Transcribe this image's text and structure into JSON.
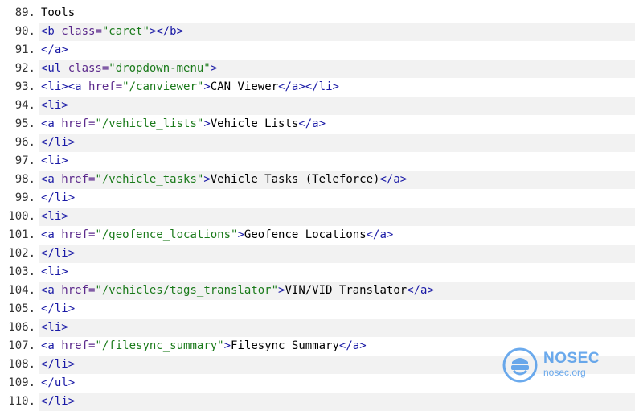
{
  "watermark": {
    "name": "NOSEC",
    "domain": "nosec.org"
  },
  "lines": [
    {
      "n": "89.",
      "parts": [
        {
          "c": "plain",
          "t": "Tools"
        }
      ]
    },
    {
      "n": "90.",
      "parts": [
        {
          "c": "tag",
          "t": "<b "
        },
        {
          "c": "attr",
          "t": "class="
        },
        {
          "c": "val",
          "t": "\"caret\""
        },
        {
          "c": "tag",
          "t": "></b>"
        }
      ]
    },
    {
      "n": "91.",
      "parts": [
        {
          "c": "tag",
          "t": "</a>"
        }
      ]
    },
    {
      "n": "92.",
      "parts": [
        {
          "c": "tag",
          "t": "<ul "
        },
        {
          "c": "attr",
          "t": "class="
        },
        {
          "c": "val",
          "t": "\"dropdown-menu\""
        },
        {
          "c": "tag",
          "t": ">"
        }
      ]
    },
    {
      "n": "93.",
      "parts": [
        {
          "c": "tag",
          "t": "<li><a "
        },
        {
          "c": "attr",
          "t": "href="
        },
        {
          "c": "val",
          "t": "\"/canviewer\""
        },
        {
          "c": "tag",
          "t": ">"
        },
        {
          "c": "plain",
          "t": "CAN Viewer"
        },
        {
          "c": "tag",
          "t": "</a></li>"
        }
      ]
    },
    {
      "n": "94.",
      "parts": [
        {
          "c": "tag",
          "t": "<li>"
        }
      ]
    },
    {
      "n": "95.",
      "parts": [
        {
          "c": "tag",
          "t": "<a "
        },
        {
          "c": "attr",
          "t": "href="
        },
        {
          "c": "val",
          "t": "\"/vehicle_lists\""
        },
        {
          "c": "tag",
          "t": ">"
        },
        {
          "c": "plain",
          "t": "Vehicle Lists"
        },
        {
          "c": "tag",
          "t": "</a>"
        }
      ]
    },
    {
      "n": "96.",
      "parts": [
        {
          "c": "tag",
          "t": "</li>"
        }
      ]
    },
    {
      "n": "97.",
      "parts": [
        {
          "c": "tag",
          "t": "<li>"
        }
      ]
    },
    {
      "n": "98.",
      "parts": [
        {
          "c": "tag",
          "t": "<a "
        },
        {
          "c": "attr",
          "t": "href="
        },
        {
          "c": "val",
          "t": "\"/vehicle_tasks\""
        },
        {
          "c": "tag",
          "t": ">"
        },
        {
          "c": "plain",
          "t": "Vehicle Tasks (Teleforce)"
        },
        {
          "c": "tag",
          "t": "</a>"
        }
      ]
    },
    {
      "n": "99.",
      "parts": [
        {
          "c": "tag",
          "t": "</li>"
        }
      ]
    },
    {
      "n": "100.",
      "parts": [
        {
          "c": "tag",
          "t": "<li>"
        }
      ]
    },
    {
      "n": "101.",
      "parts": [
        {
          "c": "tag",
          "t": "<a "
        },
        {
          "c": "attr",
          "t": "href="
        },
        {
          "c": "val",
          "t": "\"/geofence_locations\""
        },
        {
          "c": "tag",
          "t": ">"
        },
        {
          "c": "plain",
          "t": "Geofence Locations"
        },
        {
          "c": "tag",
          "t": "</a>"
        }
      ]
    },
    {
      "n": "102.",
      "parts": [
        {
          "c": "tag",
          "t": "</li>"
        }
      ]
    },
    {
      "n": "103.",
      "parts": [
        {
          "c": "tag",
          "t": "<li>"
        }
      ]
    },
    {
      "n": "104.",
      "parts": [
        {
          "c": "tag",
          "t": "<a "
        },
        {
          "c": "attr",
          "t": "href="
        },
        {
          "c": "val",
          "t": "\"/vehicles/tags_translator\""
        },
        {
          "c": "tag",
          "t": ">"
        },
        {
          "c": "plain",
          "t": "VIN/VID Translator"
        },
        {
          "c": "tag",
          "t": "</a>"
        }
      ]
    },
    {
      "n": "105.",
      "parts": [
        {
          "c": "tag",
          "t": "</li>"
        }
      ]
    },
    {
      "n": "106.",
      "parts": [
        {
          "c": "tag",
          "t": "<li>"
        }
      ]
    },
    {
      "n": "107.",
      "parts": [
        {
          "c": "tag",
          "t": "<a "
        },
        {
          "c": "attr",
          "t": "href="
        },
        {
          "c": "val",
          "t": "\"/filesync_summary\""
        },
        {
          "c": "tag",
          "t": ">"
        },
        {
          "c": "plain",
          "t": "Filesync Summary"
        },
        {
          "c": "tag",
          "t": "</a>"
        }
      ]
    },
    {
      "n": "108.",
      "parts": [
        {
          "c": "tag",
          "t": "</li>"
        }
      ]
    },
    {
      "n": "109.",
      "parts": [
        {
          "c": "tag",
          "t": "</ul>"
        }
      ]
    },
    {
      "n": "110.",
      "parts": [
        {
          "c": "tag",
          "t": "</li>"
        }
      ]
    }
  ]
}
